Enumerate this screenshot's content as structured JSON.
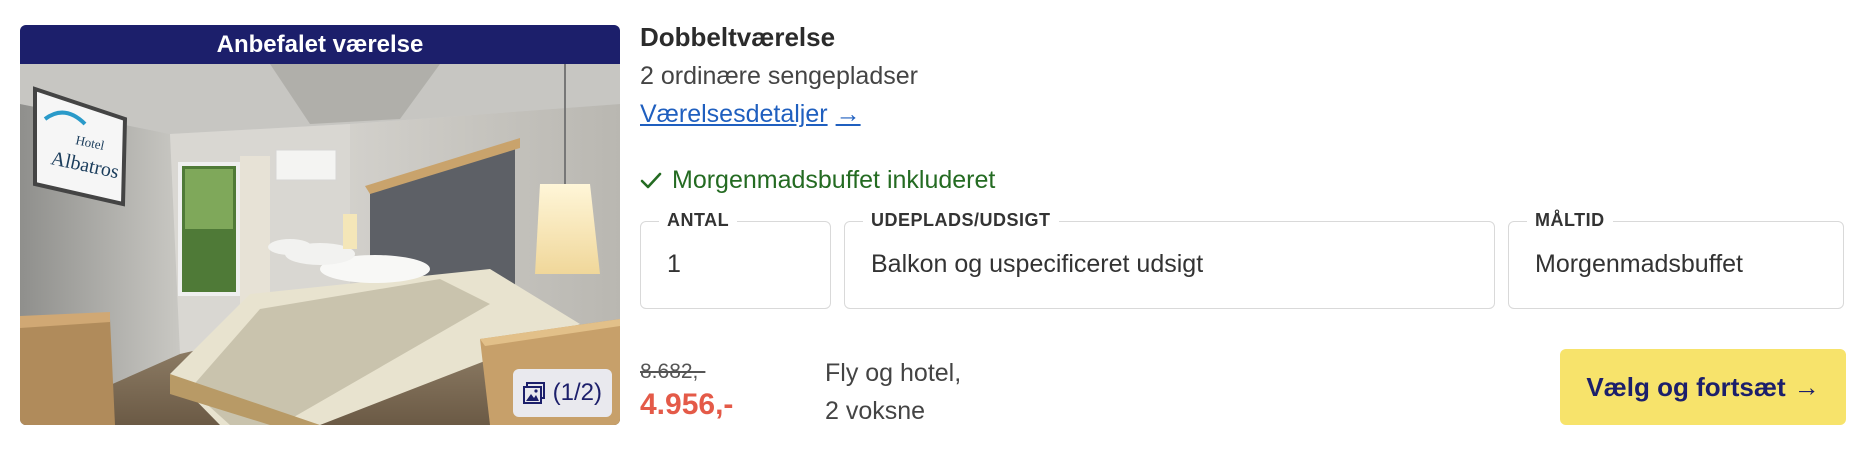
{
  "room": {
    "banner": "Anbefalet værelse",
    "gallery_counter": "(1/2)",
    "title": "Dobbeltværelse",
    "beds": "2 ordinære sengepladser",
    "details_link": "Værelsesdetaljer",
    "benefit": "Morgenmadsbuffet inkluderet"
  },
  "fields": {
    "antal": {
      "label": "ANTAL",
      "value": "1"
    },
    "udsigt": {
      "label": "UDEPLADS/UDSIGT",
      "value": "Balkon og uspecificeret udsigt"
    },
    "maaltid": {
      "label": "MÅLTID",
      "value": "Morgenmadsbuffet"
    }
  },
  "price": {
    "old": "8.682,-",
    "new": "4.956,-",
    "package_line1": "Fly og hotel,",
    "package_line2": "2 voksne"
  },
  "cta": {
    "label": "Vælg og fortsæt"
  },
  "photo_sign": {
    "line1": "Hotel",
    "line2": "Albatros"
  },
  "colors": {
    "banner": "#1c1f6b",
    "price_new": "#e45a48",
    "cta": "#f7e36b",
    "link": "#1f5fbf",
    "benefit": "#246b22"
  },
  "icons": [
    "gallery-icon",
    "arrow-right-icon",
    "checkmark-icon"
  ]
}
